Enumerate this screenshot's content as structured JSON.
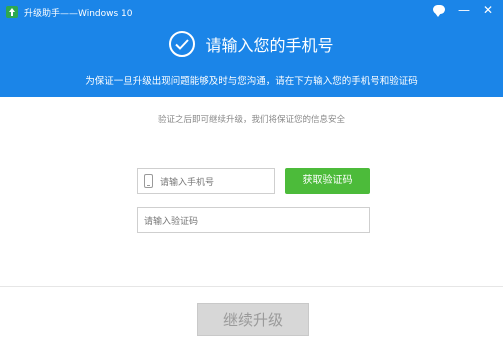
{
  "window": {
    "title": "升级助手——Windows 10",
    "minimize": "—",
    "close": "✕"
  },
  "header": {
    "title": "请输入您的手机号",
    "subtitle": "为保证一旦升级出现问题能够及时与您沟通，请在下方输入您的手机号和验证码",
    "bg_color": "#1b85e8"
  },
  "form": {
    "hint": "验证之后即可继续升级，我们将保证您的信息安全",
    "phone_placeholder": "请输入手机号",
    "get_code_label": "获取验证码",
    "code_placeholder": "请输入验证码",
    "continue_label": "继续升级",
    "accent_color": "#4cbb3a"
  },
  "icons": [
    "app-icon",
    "chat-icon",
    "minimize-icon",
    "close-icon",
    "check-circle-icon",
    "phone-icon"
  ]
}
